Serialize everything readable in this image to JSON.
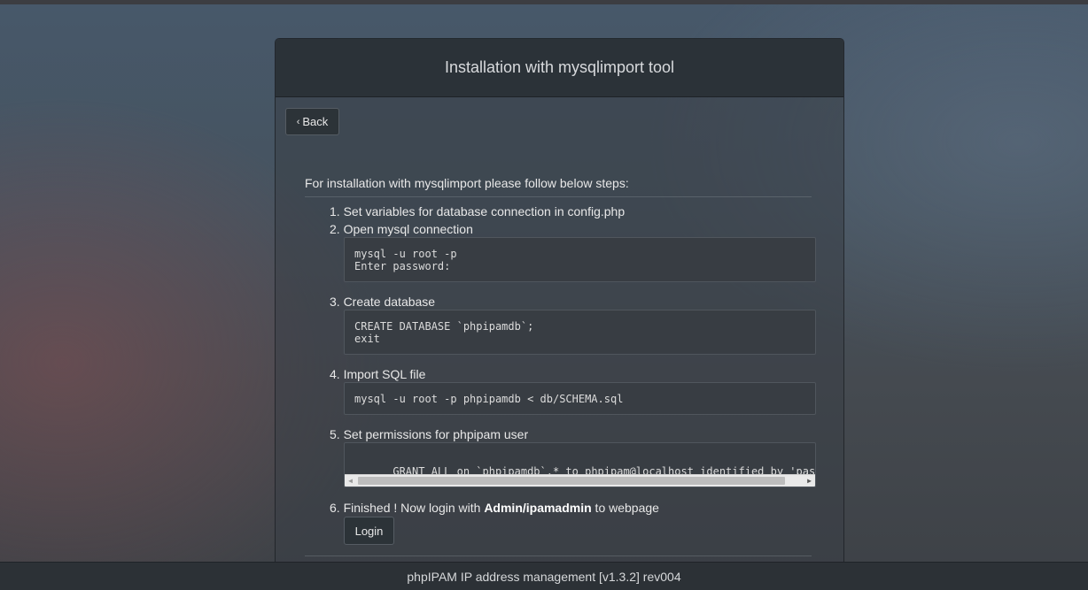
{
  "panel": {
    "title": "Installation with mysqlimport tool",
    "back_label": "Back"
  },
  "intro": "For installation with mysqlimport please follow below steps:",
  "steps": [
    {
      "label": "1. Set variables for database connection in config.php"
    },
    {
      "label": "2. Open mysql connection",
      "code": "mysql -u root -p\nEnter password:"
    },
    {
      "label": "3. Create database",
      "code": "CREATE DATABASE `phpipamdb`;\nexit"
    },
    {
      "label": "4. Import SQL file",
      "code": "mysql -u root -p phpipamdb < db/SCHEMA.sql"
    },
    {
      "label": "5. Set permissions for phpipam user",
      "code": "GRANT ALL on `phpipamdb`.* to phpipam@localhost identified by 'password'; FLUSH PRIVILEGES; exit"
    },
    {
      "label_prefix": "6. Finished ! Now login with ",
      "label_bold": "Admin/ipamadmin",
      "label_suffix": " to webpage",
      "login_label": "Login"
    }
  ],
  "footer": "phpIPAM IP address management [v1.3.2] rev004"
}
